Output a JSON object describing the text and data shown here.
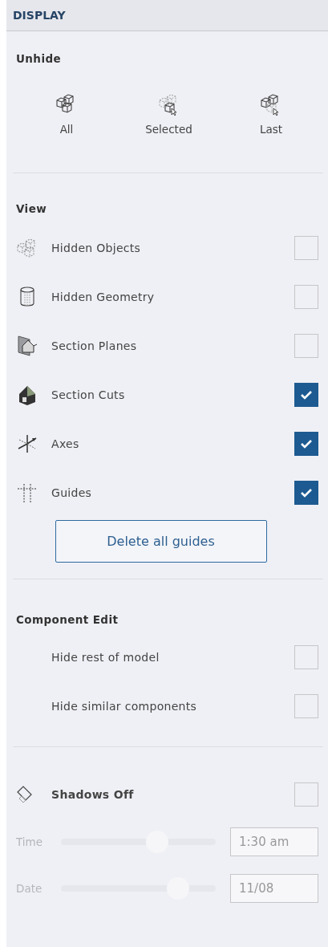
{
  "header": {
    "title": "DISPLAY"
  },
  "unhide": {
    "title": "Unhide",
    "buttons": [
      {
        "label": "All"
      },
      {
        "label": "Selected"
      },
      {
        "label": "Last"
      }
    ]
  },
  "view": {
    "title": "View",
    "items": [
      {
        "label": "Hidden Objects",
        "checked": false
      },
      {
        "label": "Hidden Geometry",
        "checked": false
      },
      {
        "label": "Section Planes",
        "checked": false
      },
      {
        "label": "Section Cuts",
        "checked": true
      },
      {
        "label": "Axes",
        "checked": true
      },
      {
        "label": "Guides",
        "checked": true
      }
    ],
    "button": "Delete all guides"
  },
  "component_edit": {
    "title": "Component Edit",
    "items": [
      {
        "label": "Hide rest of model",
        "checked": false
      },
      {
        "label": "Hide similar components",
        "checked": false
      }
    ]
  },
  "shadows": {
    "label": "Shadows Off",
    "checked": false,
    "sliders": [
      {
        "label": "Time",
        "level": 0.64,
        "value": "1:30 am",
        "disabled": true
      },
      {
        "label": "Date",
        "level": 0.8,
        "value": "11/08",
        "disabled": true
      }
    ]
  }
}
